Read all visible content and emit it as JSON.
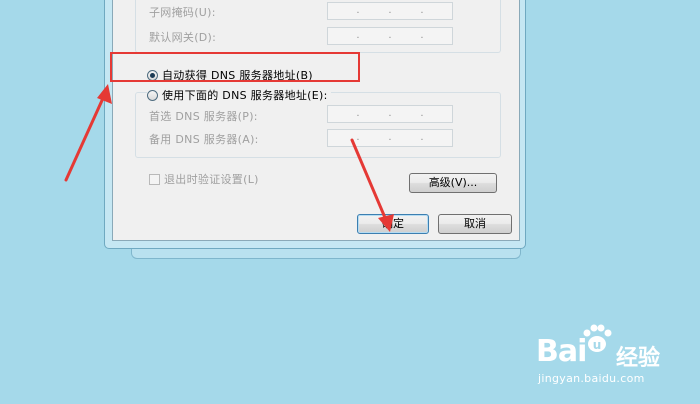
{
  "dialog": {
    "top_group": {
      "subnet_label": "子网掩码(U):",
      "gateway_label": "默认网关(D):"
    },
    "dns_auto_label": "自动获得 DNS 服务器地址(B)",
    "dns_manual_label": "使用下面的 DNS 服务器地址(E):",
    "preferred_dns_label": "首选 DNS 服务器(P):",
    "alternate_dns_label": "备用 DNS 服务器(A):",
    "validate_label": "退出时验证设置(L)",
    "advanced_button": "高级(V)...",
    "ok_button": "确定",
    "cancel_button": "取消",
    "ip_dot": "."
  },
  "watermark": {
    "logo": "Bai",
    "logo_suffix": "u",
    "cn": "经验",
    "url": "jingyan.baidu.com"
  },
  "colors": {
    "background": "#a5d9ea",
    "annotation_red": "#e53935"
  }
}
